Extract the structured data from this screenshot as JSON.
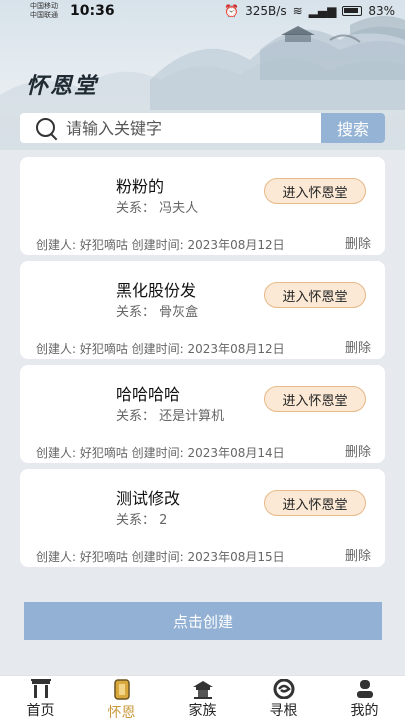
{
  "status_bar": {
    "carrier_1": "中国移动",
    "carrier_2": "中国联通",
    "time": "10:36",
    "speed": "325B/s",
    "battery": "83%"
  },
  "app": {
    "logo": "怀恩堂"
  },
  "search": {
    "placeholder": "请输入关键字",
    "button": "搜索"
  },
  "cards": [
    {
      "name": "粉粉的",
      "relation": "关系：  冯夫人",
      "enter": "进入怀恩堂",
      "meta": "创建人:  好犯嘀咕  创建时间:  2023年08月12日",
      "delete": "删除"
    },
    {
      "name": "黑化股份发",
      "relation": "关系：  骨灰盒",
      "enter": "进入怀恩堂",
      "meta": "创建人:  好犯嘀咕  创建时间:  2023年08月12日",
      "delete": "删除"
    },
    {
      "name": "哈哈哈哈",
      "relation": "关系：  还是计算机",
      "enter": "进入怀恩堂",
      "meta": "创建人:  好犯嘀咕  创建时间:  2023年08月14日",
      "delete": "删除"
    },
    {
      "name": "测试修改",
      "relation": "关系：  2",
      "enter": "进入怀恩堂",
      "meta": "创建人:  好犯嘀咕  创建时间:  2023年08月15日",
      "delete": "删除"
    }
  ],
  "create_button": "点击创建",
  "tabs": [
    {
      "label": "首页",
      "icon": "home-gate-icon"
    },
    {
      "label": "怀恩",
      "icon": "memorial-tablet-icon"
    },
    {
      "label": "家族",
      "icon": "family-pavilion-icon"
    },
    {
      "label": "寻根",
      "icon": "roots-swirl-icon"
    },
    {
      "label": "我的",
      "icon": "profile-icon"
    }
  ],
  "colors": {
    "accent": "#93b1d4",
    "enter_button_bg": "#fbe8d5",
    "active_tab": "#c99a3d"
  }
}
